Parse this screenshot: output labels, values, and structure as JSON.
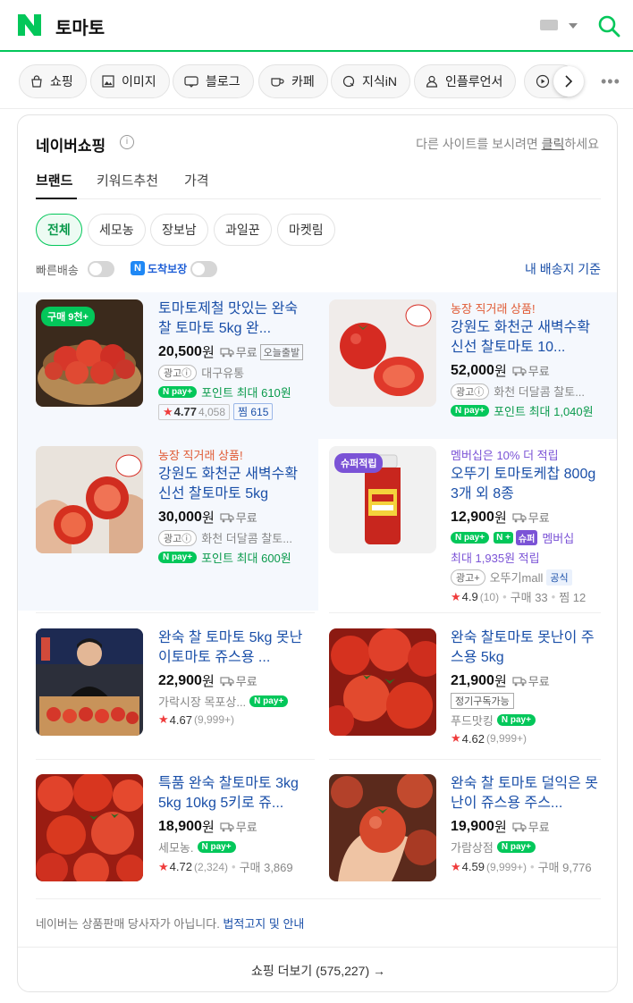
{
  "search": {
    "query": "토마토"
  },
  "tabs": [
    {
      "label": "쇼핑",
      "icon": "shopping-bag-icon"
    },
    {
      "label": "이미지",
      "icon": "image-icon"
    },
    {
      "label": "블로그",
      "icon": "blog-icon"
    },
    {
      "label": "카페",
      "icon": "cafe-icon"
    },
    {
      "label": "지식iN",
      "icon": "kin-icon"
    },
    {
      "label": "인플루언서",
      "icon": "person-icon"
    }
  ],
  "card": {
    "title": "네이버쇼핑",
    "hint_prefix": "다른 사이트를 보시려면 ",
    "hint_link": "클릭",
    "hint_suffix": "하세요",
    "subtabs": [
      "브랜드",
      "키워드추천",
      "가격"
    ],
    "filters": [
      "전체",
      "세모농",
      "장보남",
      "과일꾼",
      "마켓림"
    ],
    "toggles": {
      "fast_delivery": "빠른배송",
      "arrival_guarantee": "도착보장"
    },
    "ship_base": "내 배송지 기준"
  },
  "products": [
    {
      "badge": "구매 9천+",
      "title": "토마토제철 맛있는 완숙 찰 토마토 5kg 완...",
      "price": "20,500",
      "price_unit": "원",
      "shipping": "무료",
      "today_tag": "오늘출발",
      "ad_label": "광고ⓘ",
      "seller": "대구유통",
      "npay": "N pay+",
      "point": "포인트 최대 610원",
      "rating": "4.77",
      "reviews": "4,058",
      "wish_label": "찜 615"
    },
    {
      "farm": "농장 직거래 상품!",
      "title": "강원도 화천군 새벽수확 신선 찰토마토 10...",
      "price": "52,000",
      "price_unit": "원",
      "shipping": "무료",
      "ad_label": "광고ⓘ",
      "seller": "화천 더달콤 찰토...",
      "npay": "N pay+",
      "point": "포인트 최대 1,040원"
    },
    {
      "farm": "농장 직거래 상품!",
      "title": "강원도 화천군 새벽수확 신선 찰토마토 5kg",
      "price": "30,000",
      "price_unit": "원",
      "shipping": "무료",
      "ad_label": "광고ⓘ",
      "seller": "화천 더달콤 찰토...",
      "npay": "N pay+",
      "point": "포인트 최대 600원"
    },
    {
      "badge": "슈퍼적립",
      "member": "멤버십은 10% 더 적립",
      "title": "오뚜기 토마토케찹 800g 3개 외 8종",
      "price": "12,900",
      "price_unit": "원",
      "shipping": "무료",
      "npay": "N pay+",
      "nplus": "N +",
      "super": "슈퍼",
      "membership": "멤버십",
      "mileage": "최대 1,935원 적립",
      "ad_label": "광고+",
      "seller": "오뚜기mall",
      "official": "공식",
      "rating": "4.9",
      "reviews": "10",
      "purchase": "구매 33",
      "wish": "찜 12"
    },
    {
      "title": "완숙 찰 토마토 5kg 못난이토마토 쥬스용 ...",
      "price": "22,900",
      "price_unit": "원",
      "shipping": "무료",
      "seller": "가락시장 목포상...",
      "npay": "N pay+",
      "rating": "4.67",
      "reviews": "9,999+"
    },
    {
      "title": "완숙 찰토마토 못난이 주스용 5kg",
      "price": "21,900",
      "price_unit": "원",
      "shipping": "무료",
      "sub_tag": "정기구독가능",
      "seller": "푸드맛킹",
      "npay": "N pay+",
      "rating": "4.62",
      "reviews": "9,999+"
    },
    {
      "title": "특품 완숙 찰토마토 3kg 5kg 10kg 5키로 쥬...",
      "price": "18,900",
      "price_unit": "원",
      "shipping": "무료",
      "seller": "세모농.",
      "npay": "N pay+",
      "rating": "4.72",
      "reviews": "2,324",
      "purchase": "구매 3,869"
    },
    {
      "title": "완숙 찰 토마토 덜익은 못난이 쥬스용 주스...",
      "price": "19,900",
      "price_unit": "원",
      "shipping": "무료",
      "seller": "가람상점",
      "npay": "N pay+",
      "rating": "4.59",
      "reviews": "9,999+",
      "purchase": "구매 9,776"
    }
  ],
  "footer": {
    "note": "네이버는 상품판매 당사자가 아닙니다. ",
    "link": "법적고지 및 안내",
    "more": "쇼핑 더보기 (575,227) →"
  },
  "colors": {
    "naver_green": "#03c75a",
    "link_blue": "#1a4fa8",
    "farm_orange": "#e05a34",
    "member_purple": "#7b53d6"
  }
}
